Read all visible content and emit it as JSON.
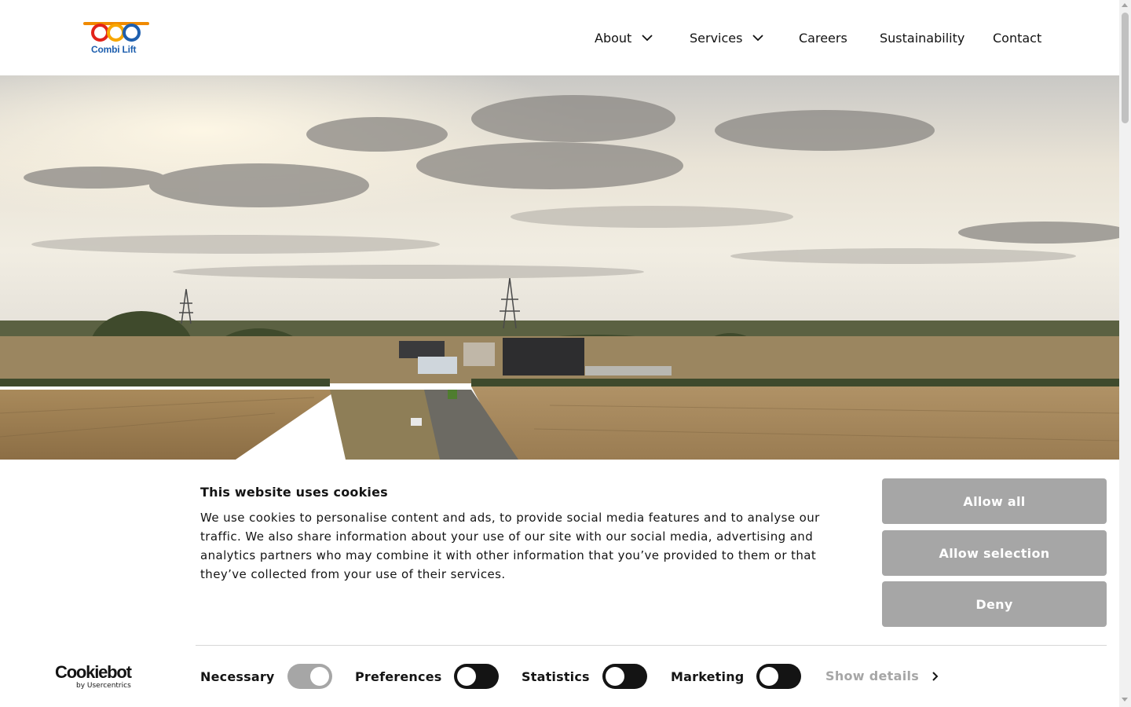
{
  "brand": {
    "name": "Combi Lift",
    "logo_colors": [
      "#f08a00",
      "#e2231a",
      "#f7a600",
      "#1e5fae"
    ]
  },
  "nav": {
    "items": [
      {
        "label": "About",
        "has_dropdown": true,
        "icon": "chevron-down-icon"
      },
      {
        "label": "Services",
        "has_dropdown": true,
        "icon": "chevron-down-icon"
      },
      {
        "label": "Careers",
        "has_dropdown": false
      },
      {
        "label": "Sustainability",
        "has_dropdown": false
      },
      {
        "label": "Contact",
        "has_dropdown": false
      }
    ]
  },
  "hero": {
    "image": "aerial-landscape-substation-construction-site"
  },
  "cookie_banner": {
    "title": "This website uses cookies",
    "body": "We use cookies to personalise content and ads, to provide social media features and to analyse our traffic. We also share information about your use of our site with our social media, advertising and analytics partners who may combine it with other information that you’ve provided to them or that they’ve collected from your use of their services.",
    "buttons": {
      "allow_all": "Allow all",
      "allow_selection": "Allow selection",
      "deny": "Deny"
    },
    "provider": {
      "name": "Cookiebot",
      "sub": "by Usercentrics"
    },
    "toggles": [
      {
        "label": "Necessary",
        "checked": true,
        "disabled": true
      },
      {
        "label": "Preferences",
        "checked": false,
        "disabled": false
      },
      {
        "label": "Statistics",
        "checked": false,
        "disabled": false
      },
      {
        "label": "Marketing",
        "checked": false,
        "disabled": false
      }
    ],
    "show_details": "Show details",
    "button_color": "#a6a6a6"
  }
}
